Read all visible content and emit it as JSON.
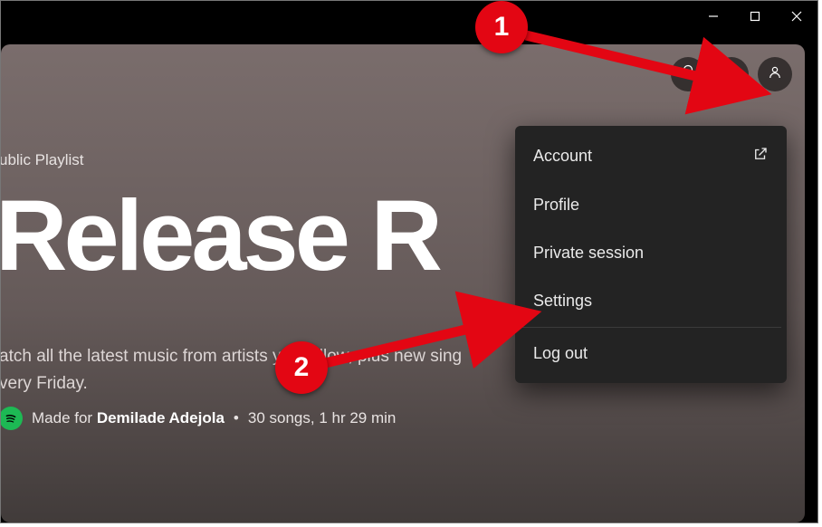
{
  "playlist": {
    "subheader": "ublic Playlist",
    "title": "Release R",
    "description_line1": "atch all the latest music from artists you follow, plus new sing",
    "description_line2": "very Friday.",
    "made_for_prefix": "Made for",
    "made_for_name": "Demilade Adejola",
    "stats": "30 songs, 1 hr 29 min",
    "separator": "•"
  },
  "menu": {
    "account": "Account",
    "profile": "Profile",
    "private_session": "Private session",
    "settings": "Settings",
    "logout": "Log out"
  },
  "annotations": {
    "step1": "1",
    "step2": "2"
  }
}
